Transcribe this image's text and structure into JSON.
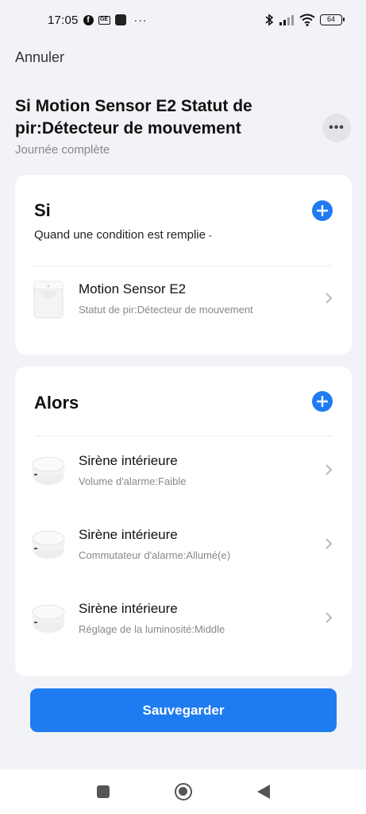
{
  "status_bar": {
    "time": "17:05",
    "battery": "64"
  },
  "header": {
    "cancel_label": "Annuler",
    "title": "Si Motion Sensor E2 Statut de pir:Détecteur de mouvement",
    "subtitle": "Journée complète"
  },
  "if_section": {
    "heading": "Si",
    "condition_mode": "Quand une condition est remplie",
    "items": [
      {
        "title": "Motion Sensor E2",
        "subtitle": "Statut de pir:Détecteur de mouvement",
        "icon": "motion-sensor-icon"
      }
    ]
  },
  "then_section": {
    "heading": "Alors",
    "items": [
      {
        "title": "Sirène intérieure",
        "subtitle": "Volume d'alarme:Faible",
        "icon": "siren-icon"
      },
      {
        "title": "Sirène intérieure",
        "subtitle": "Commutateur d'alarme:Allumé(e)",
        "icon": "siren-icon"
      },
      {
        "title": "Sirène intérieure",
        "subtitle": "Réglage de la luminosité:Middle",
        "icon": "siren-icon"
      }
    ]
  },
  "footer": {
    "save_label": "Sauvegarder"
  },
  "colors": {
    "accent": "#1f7cf0",
    "background": "#f2f3f7"
  }
}
